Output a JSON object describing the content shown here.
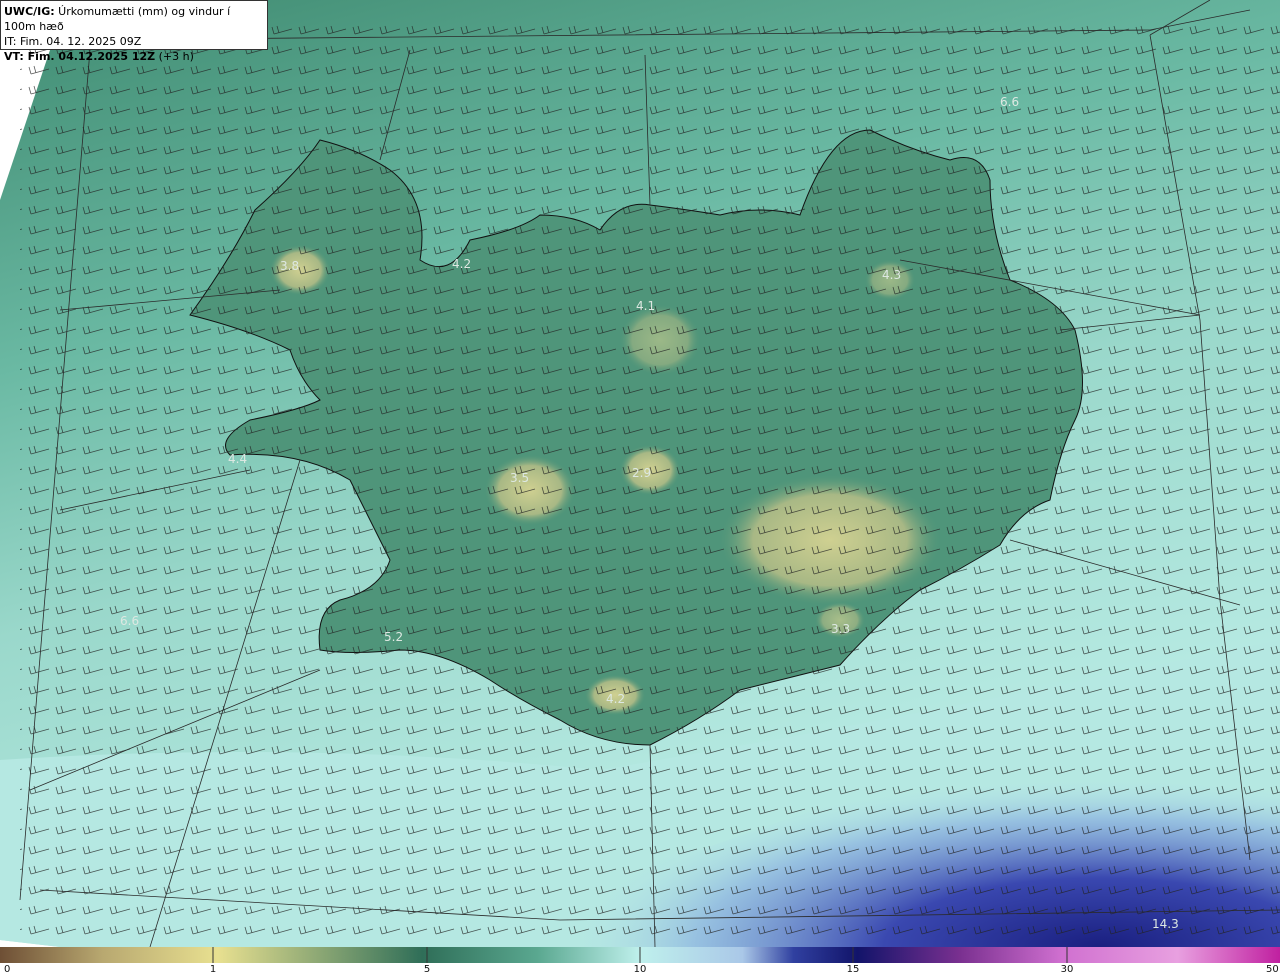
{
  "header": {
    "product": "UWC/IG:",
    "description": " Úrkomumætti (mm) og vindur í 100m hæð",
    "issue_time": "IT: Fim. 04. 12. 2025 09Z",
    "valid_prefix": "VT:",
    "valid_time": " Fim. 04.12.2025 12Z",
    "valid_offset": " (+3 h)"
  },
  "value_labels": [
    {
      "text": "6.6"
    },
    {
      "text": "3.8"
    },
    {
      "text": "4.2"
    },
    {
      "text": "4.3"
    },
    {
      "text": "4.1"
    },
    {
      "text": "4.4"
    },
    {
      "text": "3.5"
    },
    {
      "text": "2.9"
    },
    {
      "text": "6.6"
    },
    {
      "text": "5.2"
    },
    {
      "text": "3.3"
    },
    {
      "text": "4.2"
    },
    {
      "text": "14.3"
    }
  ],
  "colorbar": {
    "ticks": [
      "0",
      "1",
      "5",
      "10",
      "15",
      "30",
      "50"
    ],
    "colors": [
      "#6e4f35",
      "#b8a870",
      "#e8e090",
      "#2f6e58",
      "#5aa890",
      "#bff0ec",
      "#aac8e8",
      "#3040a0",
      "#12146a",
      "#7a3090",
      "#d070d0",
      "#e8a0e0",
      "#c020a0"
    ]
  },
  "colors": {
    "land_low": "#3f8a70",
    "land_high": "#c9cc8c",
    "sea_light": "#8fd4c6",
    "precip_heavy": "#2a36a0"
  }
}
